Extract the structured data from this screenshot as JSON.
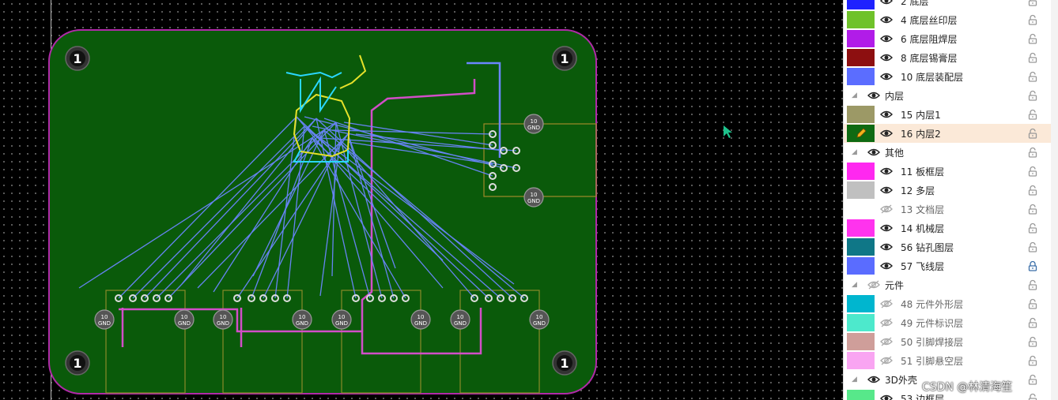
{
  "board": {
    "mount_labels": [
      "1",
      "1",
      "1",
      "1"
    ],
    "gnd_label": "GND",
    "pad_label": "10"
  },
  "layers": [
    {
      "type": "layer",
      "label": "2 底层",
      "color": "#1e22ff",
      "visible": true
    },
    {
      "type": "layer",
      "label": "4 底层丝印层",
      "color": "#6fc22a",
      "visible": true
    },
    {
      "type": "layer",
      "label": "6 底层阻焊层",
      "color": "#b11ce8",
      "visible": true
    },
    {
      "type": "layer",
      "label": "8 底层锡膏层",
      "color": "#8d0f10",
      "visible": true
    },
    {
      "type": "layer",
      "label": "10 底层装配层",
      "color": "#5b6dff",
      "visible": true
    },
    {
      "type": "group",
      "label": "内层",
      "visible": true
    },
    {
      "type": "layer",
      "label": "15 内层1",
      "color": "#9c9966",
      "visible": true
    },
    {
      "type": "layer",
      "label": "16 内层2",
      "color": "#0f6a12",
      "visible": true,
      "selected": true
    },
    {
      "type": "group",
      "label": "其他",
      "visible": true
    },
    {
      "type": "layer",
      "label": "11 板框层",
      "color": "#ff28f0",
      "visible": true
    },
    {
      "type": "layer",
      "label": "12 多层",
      "color": "#c0c0c0",
      "visible": true
    },
    {
      "type": "layer",
      "label": "13 文档层",
      "color": "#ffffff",
      "visible": false
    },
    {
      "type": "layer",
      "label": "14 机械层",
      "color": "#ff33ee",
      "visible": true
    },
    {
      "type": "layer",
      "label": "56 钻孔图层",
      "color": "#0f7787",
      "visible": true
    },
    {
      "type": "layer",
      "label": "57 飞线层",
      "color": "#5a6cff",
      "visible": true,
      "locked": true
    },
    {
      "type": "group",
      "label": "元件",
      "visible": false
    },
    {
      "type": "layer",
      "label": "48 元件外形层",
      "color": "#00b6cf",
      "visible": false
    },
    {
      "type": "layer",
      "label": "49 元件标识层",
      "color": "#4de9cc",
      "visible": false
    },
    {
      "type": "layer",
      "label": "50 引脚焊接层",
      "color": "#cf9e9a",
      "visible": false
    },
    {
      "type": "layer",
      "label": "51 引脚悬空层",
      "color": "#f9a5f2",
      "visible": false
    },
    {
      "type": "group",
      "label": "3D外壳",
      "visible": true
    },
    {
      "type": "layer",
      "label": "53 边框层",
      "color": "#57e88a",
      "visible": true
    }
  ],
  "watermark": "CSDN @林清海笙"
}
